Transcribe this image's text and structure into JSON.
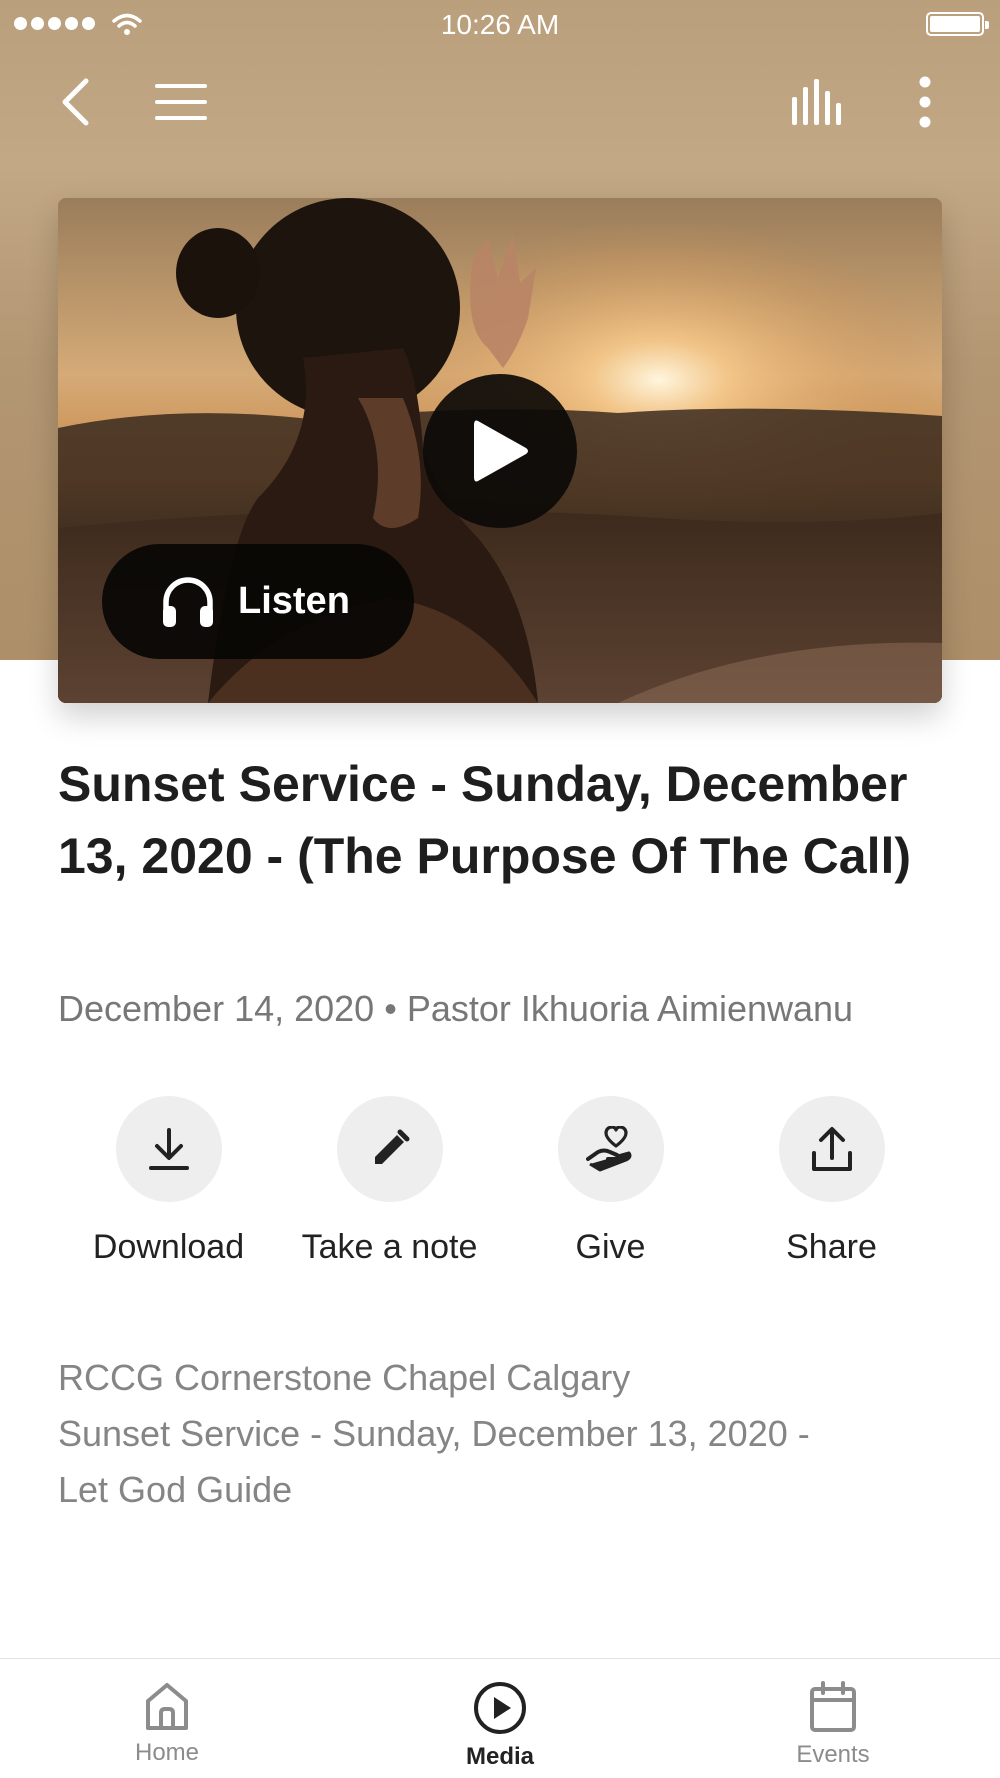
{
  "status_bar": {
    "time": "10:26 AM",
    "signal_bars": 5,
    "battery_level": 1.0
  },
  "nav": {
    "back_icon": "chevron-left-icon",
    "menu_icon": "hamburger-menu-icon",
    "stats_icon": "audio-bars-icon",
    "more_icon": "vertical-dots-icon"
  },
  "media": {
    "play_icon": "play-icon",
    "listen_label": "Listen",
    "listen_icon": "headphones-icon"
  },
  "sermon": {
    "title": "Sunset Service - Sunday, December 13, 2020 - (The Purpose Of The Call)",
    "date": "December 14, 2020",
    "separator": "•",
    "speaker": "Pastor Ikhuoria Aimienwanu"
  },
  "actions": [
    {
      "label": "Download",
      "icon": "download-icon"
    },
    {
      "label": "Take a note",
      "icon": "pencil-icon"
    },
    {
      "label": "Give",
      "icon": "give-heart-hand-icon"
    },
    {
      "label": "Share",
      "icon": "share-icon"
    }
  ],
  "description": {
    "line1": "RCCG Cornerstone Chapel Calgary",
    "line2": "Sunset Service - Sunday, December 13, 2020 -",
    "line3": "Let God Guide"
  },
  "tabs": [
    {
      "label": "Home",
      "icon": "home-icon",
      "active": false
    },
    {
      "label": "Media",
      "icon": "play-circle-icon",
      "active": true
    },
    {
      "label": "Events",
      "icon": "calendar-icon",
      "active": false
    }
  ],
  "colors": {
    "header_background": "#b89c78",
    "text_primary": "#1e1e1e",
    "text_secondary": "#777777",
    "action_circle": "#eeeeee",
    "tab_inactive": "#8c8c8c"
  }
}
